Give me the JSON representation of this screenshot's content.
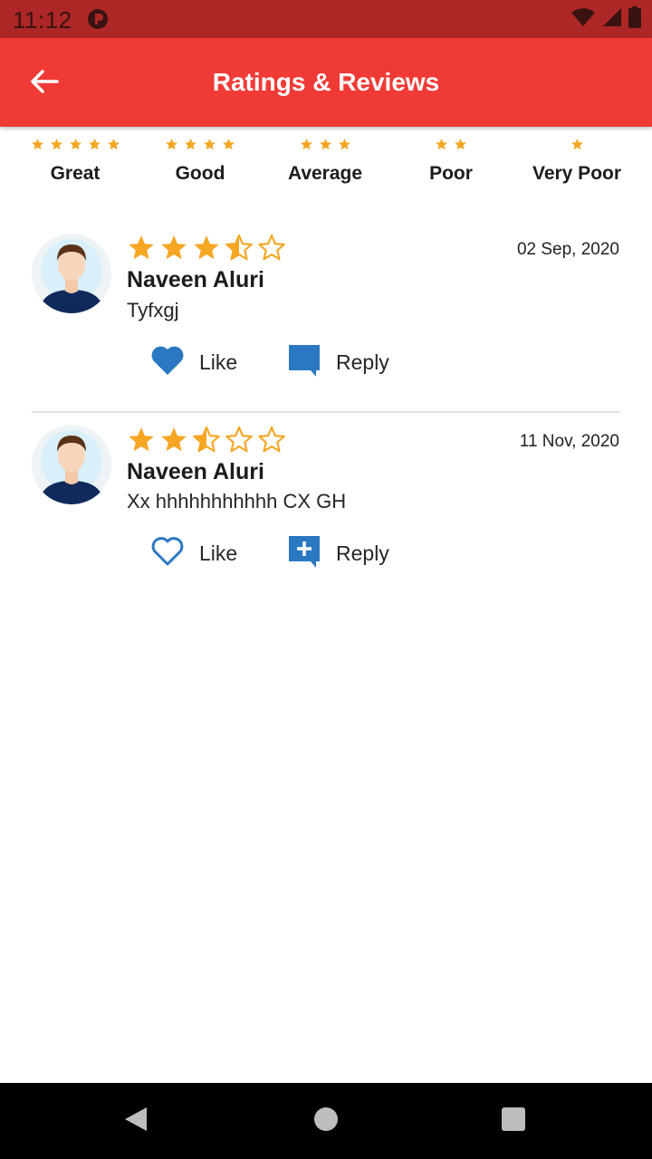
{
  "status_bar": {
    "time": "11:12"
  },
  "header": {
    "title": "Ratings & Reviews"
  },
  "filters": [
    {
      "label": "Great",
      "stars": 5
    },
    {
      "label": "Good",
      "stars": 4
    },
    {
      "label": "Average",
      "stars": 3
    },
    {
      "label": "Poor",
      "stars": 2
    },
    {
      "label": "Very Poor",
      "stars": 1
    }
  ],
  "reviews": [
    {
      "name": "Naveen Aluri",
      "text": "Tyfxgj",
      "date": "02 Sep, 2020",
      "rating": 3.5,
      "like_label": "Like",
      "reply_label": "Reply",
      "liked": true
    },
    {
      "name": "Naveen Aluri",
      "text": "Xx hhhhhhhhhhh CX GH",
      "date": "11 Nov, 2020",
      "rating": 2.5,
      "like_label": "Like",
      "reply_label": "Reply",
      "liked": false
    }
  ],
  "colors": {
    "app_bar": "#ef3a36",
    "status_bar": "#ad2727",
    "star": "#f5a623",
    "icon_blue": "#2b78c2"
  }
}
